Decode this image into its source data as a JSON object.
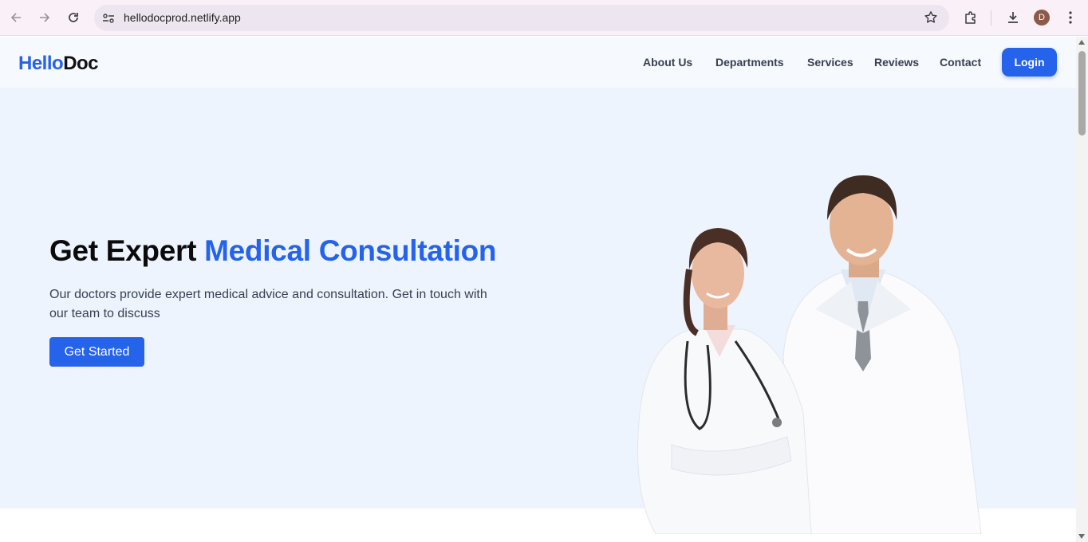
{
  "browser": {
    "url": "hellodocprod.netlify.app",
    "profile_initial": "D",
    "icons": [
      "back-icon",
      "forward-icon",
      "reload-icon",
      "site-info-icon",
      "bookmark-star-icon",
      "extensions-icon",
      "downloads-icon",
      "menu-icon"
    ]
  },
  "header": {
    "logo_part1": "Hello",
    "logo_part2": "Doc",
    "nav": [
      "About Us",
      "Departments",
      "Services",
      "Reviews",
      "Contact"
    ],
    "login_label": "Login"
  },
  "hero": {
    "title_part1": "Get Expert ",
    "title_part2": "Medical Consultation",
    "subtitle": "Our doctors provide expert medical advice and consultation. Get in touch with our team to discuss",
    "cta_label": "Get Started",
    "image_name": "doctors-photo"
  },
  "colors": {
    "accent": "#2563eb",
    "hero_bg": "#eef4fe",
    "header_bg": "#f6f9fe"
  }
}
